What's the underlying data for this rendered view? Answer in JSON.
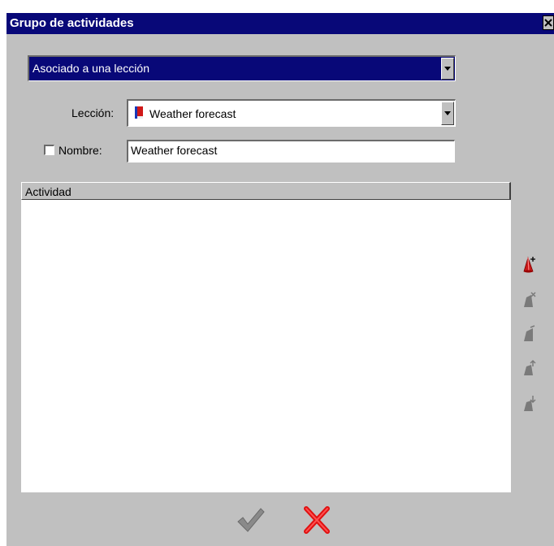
{
  "window": {
    "title": "Grupo de actividades",
    "close_icon": "close-icon",
    "colors": {
      "titlebar": "#080878",
      "face": "#c0c0c0",
      "selection": "#080878"
    }
  },
  "association": {
    "selected": "Asociado a una lección"
  },
  "lesson": {
    "label": "Lección:",
    "selected": "Weather forecast",
    "icon": "book-icon"
  },
  "name": {
    "checkbox_label": "Nombre:",
    "checked": false,
    "value": "Weather forecast"
  },
  "activities": {
    "columns": [
      "Actividad"
    ],
    "rows": []
  },
  "side_toolbar": {
    "icons": [
      "add-activity-icon",
      "delete-activity-icon",
      "edit-activity-icon",
      "move-up-icon",
      "move-down-icon"
    ],
    "enabled": [
      true,
      false,
      false,
      false,
      false
    ]
  },
  "footer": {
    "ok_icon": "checkmark-icon",
    "cancel_icon": "red-x-icon",
    "ok_enabled": false
  }
}
